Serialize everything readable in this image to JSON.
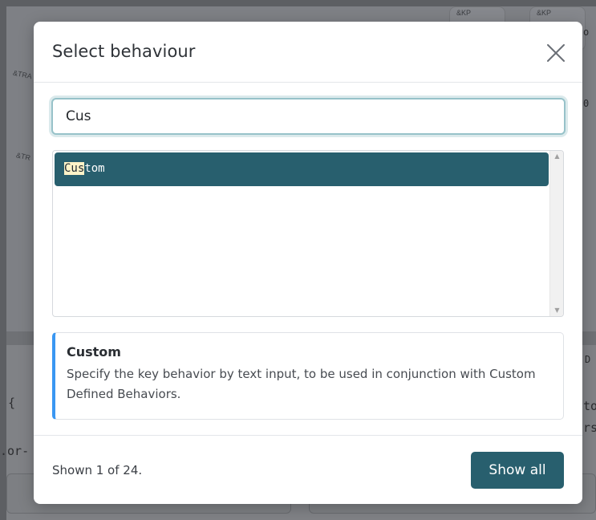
{
  "background": {
    "keycap_labels": [
      "&KP",
      "&KP"
    ],
    "side_labels": [
      "&TRA",
      "&TR"
    ],
    "code_fragments": [
      "{",
      ".or-",
      "to",
      "rs",
      "0",
      "D",
      "o"
    ]
  },
  "dialog": {
    "title": "Select behaviour",
    "close_icon": "close-icon",
    "search": {
      "value": "Cus",
      "placeholder": ""
    },
    "results": [
      {
        "match": "Cus",
        "rest": "tom",
        "selected": true
      }
    ],
    "detail": {
      "title": "Custom",
      "description": "Specify the key behavior by text input, to be used in conjunction with Custom Defined Behaviors."
    },
    "footer": {
      "shown_text": "Shown 1 of 24.",
      "show_all_label": "Show all"
    }
  },
  "colors": {
    "accent": "#285f6e",
    "highlight": "#fff3c8",
    "info_border": "#3a97f2",
    "focus_ring": "#97c2c9"
  }
}
